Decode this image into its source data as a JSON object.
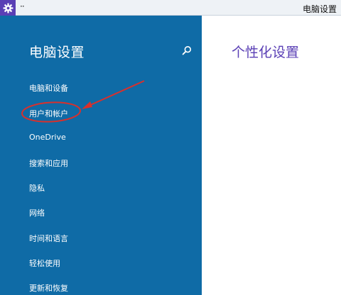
{
  "window": {
    "title": "电脑设置",
    "menu_glyph": "··"
  },
  "icons": {
    "app": "gear-icon",
    "search": "search-icon",
    "annotation": "red-arrow-circle"
  },
  "colors": {
    "sidebar_bg": "#0f6ba6",
    "accent": "#5a3fb5",
    "annotation": "#d9302c"
  },
  "sidebar": {
    "title": "电脑设置",
    "items": [
      {
        "label": "电脑和设备"
      },
      {
        "label": "用户和帐户"
      },
      {
        "label": "OneDrive"
      },
      {
        "label": "搜索和应用"
      },
      {
        "label": "隐私"
      },
      {
        "label": "网络"
      },
      {
        "label": "时间和语言"
      },
      {
        "label": "轻松使用"
      },
      {
        "label": "更新和恢复"
      }
    ]
  },
  "main": {
    "title": "个性化设置"
  }
}
